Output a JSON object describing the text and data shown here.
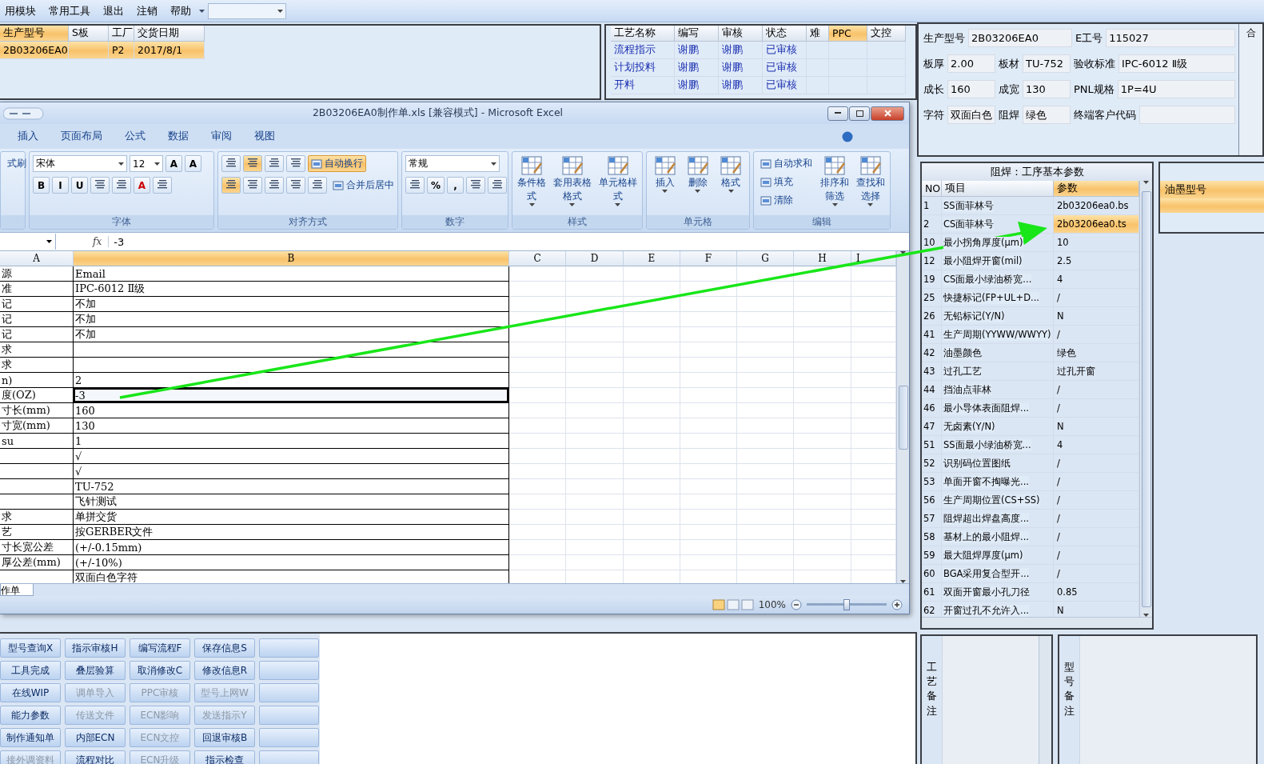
{
  "menu": {
    "items": [
      "用模块",
      "常用工具",
      "退出",
      "注销",
      "帮助"
    ]
  },
  "order_grid": {
    "columns": [
      {
        "label": "生产型号",
        "selected": true
      },
      {
        "label": "S板",
        "selected": false
      },
      {
        "label": "工厂",
        "selected": false
      },
      {
        "label": "交货日期",
        "selected": false
      }
    ],
    "rows": [
      {
        "cells": [
          "2B03206EA0",
          "",
          "P2",
          "2017/8/1"
        ],
        "selected": true
      }
    ]
  },
  "process_grid": {
    "columns": [
      {
        "label": "工艺名称",
        "selected": false
      },
      {
        "label": "编写",
        "selected": false
      },
      {
        "label": "审核",
        "selected": false
      },
      {
        "label": "状态",
        "selected": false
      },
      {
        "label": "难",
        "selected": false
      },
      {
        "label": "PPC",
        "selected": true
      },
      {
        "label": "文控",
        "selected": false
      }
    ],
    "rows": [
      {
        "cells": [
          "流程指示",
          "谢鹏",
          "谢鹏",
          "已审核",
          "",
          "",
          ""
        ]
      },
      {
        "cells": [
          "计划投料",
          "谢鹏",
          "谢鹏",
          "已审核",
          "",
          "",
          ""
        ]
      },
      {
        "cells": [
          "开料",
          "谢鹏",
          "谢鹏",
          "已审核",
          "",
          "",
          ""
        ]
      }
    ]
  },
  "excel": {
    "title": "2B03206EA0制作单.xls  [兼容模式] - Microsoft Excel",
    "tabs": [
      {
        "label": "插入",
        "selected": false
      },
      {
        "label": "页面布局",
        "selected": false
      },
      {
        "label": "公式",
        "selected": false
      },
      {
        "label": "数据",
        "selected": false
      },
      {
        "label": "审阅",
        "selected": false
      },
      {
        "label": "视图",
        "selected": false
      }
    ],
    "groups": [
      {
        "lines": [
          {
            "items": [
              {
                "kind": "small",
                "label": "式刷"
              }
            ]
          }
        ]
      },
      {
        "label": "字体",
        "lines": [
          {
            "items": [
              {
                "kind": "combo",
                "value": "宋体"
              },
              {
                "kind": "combo-small",
                "value": "12"
              },
              {
                "kind": "btn",
                "label": "A"
              },
              {
                "kind": "btn",
                "label": "A"
              }
            ]
          },
          {
            "items": [
              {
                "kind": "btn",
                "label": "B"
              },
              {
                "kind": "btn",
                "label": "I"
              },
              {
                "kind": "btn",
                "label": "U"
              },
              {
                "kind": "icon",
                "selected": false
              },
              {
                "kind": "icon",
                "selected": false
              },
              {
                "kind": "btn",
                "label": "A"
              },
              {
                "kind": "icon",
                "selected": false
              }
            ]
          }
        ]
      },
      {
        "label": "对齐方式",
        "lines": [
          {
            "items": [
              {
                "kind": "icon",
                "selected": false
              },
              {
                "kind": "icon",
                "selected": true
              },
              {
                "kind": "icon",
                "selected": false
              },
              {
                "kind": "icon",
                "selected": false
              },
              {
                "kind": "small",
                "label": "自动换行",
                "selected": true
              }
            ]
          },
          {
            "items": [
              {
                "kind": "icon",
                "selected": true
              },
              {
                "kind": "icon",
                "selected": false
              },
              {
                "kind": "icon",
                "selected": false
              },
              {
                "kind": "icon",
                "selected": false
              },
              {
                "kind": "icon",
                "selected": false
              },
              {
                "kind": "small",
                "label": "合并后居中",
                "selected": false
              }
            ]
          }
        ]
      },
      {
        "label": "数字",
        "lines": [
          {
            "items": [
              {
                "kind": "combo",
                "value": "常规"
              }
            ]
          },
          {
            "items": [
              {
                "kind": "icon",
                "selected": false
              },
              {
                "kind": "btn",
                "label": "%"
              },
              {
                "kind": "btn",
                "label": ","
              },
              {
                "kind": "icon",
                "selected": false
              },
              {
                "kind": "icon",
                "selected": false
              }
            ]
          }
        ]
      },
      {
        "label": "样式",
        "items": [
          {
            "kind": "big",
            "label": "条件格式"
          },
          {
            "kind": "big",
            "label": "套用表格格式"
          },
          {
            "kind": "big",
            "label": "单元格样式"
          }
        ]
      },
      {
        "label": "单元格",
        "items": [
          {
            "kind": "big",
            "label": "插入"
          },
          {
            "kind": "big",
            "label": "删除"
          },
          {
            "kind": "big",
            "label": "格式"
          }
        ]
      },
      {
        "label": "编辑",
        "items": [
          {
            "kind": "stack",
            "items": [
              {
                "kind": "small",
                "label": "自动求和"
              },
              {
                "kind": "small",
                "label": "填充"
              },
              {
                "kind": "small",
                "label": "清除"
              }
            ]
          },
          {
            "kind": "big",
            "label": "排序和筛选"
          },
          {
            "kind": "big",
            "label": "查找和选择"
          }
        ]
      }
    ],
    "fx": "fx",
    "formula": "-3",
    "columns": [
      {
        "label": "A",
        "selected": false
      },
      {
        "label": "B",
        "selected": true
      },
      {
        "label": "C",
        "selected": false
      },
      {
        "label": "D",
        "selected": false
      },
      {
        "label": "E",
        "selected": false
      },
      {
        "label": "F",
        "selected": false
      },
      {
        "label": "G",
        "selected": false
      },
      {
        "label": "H",
        "selected": false
      },
      {
        "label": "I",
        "selected": false
      }
    ],
    "rows": [
      {
        "a": "源",
        "b": "Email",
        "active": false
      },
      {
        "a": "准",
        "b": "IPC-6012 Ⅱ级",
        "active": false
      },
      {
        "a": "记",
        "b": "不加",
        "active": false
      },
      {
        "a": "记",
        "b": "不加",
        "active": false
      },
      {
        "a": "记",
        "b": "不加",
        "active": false
      },
      {
        "a": "求",
        "active": false
      },
      {
        "a": "求",
        "active": false
      },
      {
        "a": "n)",
        "b": "2",
        "active": false
      },
      {
        "a": "度(OZ)",
        "b": "-3",
        "active": true
      },
      {
        "a": "寸长(mm)",
        "b": "160",
        "active": false
      },
      {
        "a": "寸宽(mm)",
        "b": "130",
        "active": false
      },
      {
        "a": "su",
        "b": "1",
        "active": false
      },
      {
        "b": "√",
        "active": false
      },
      {
        "b": "√",
        "active": false
      },
      {
        "b": "TU-752",
        "active": false
      },
      {
        "b": "飞针测试",
        "active": false
      },
      {
        "a": "求",
        "b": "单拼交货",
        "active": false
      },
      {
        "a": "艺",
        "b": "按GERBER文件",
        "active": false
      },
      {
        "a": "寸长宽公差",
        "b": "(+/-0.15mm)",
        "active": false
      },
      {
        "a": "厚公差(mm)",
        "b": "(+/-10%)",
        "active": false
      },
      {
        "b": "双面白色字符",
        "active": false
      }
    ],
    "sheet_tab": "作单",
    "zoom": "100%",
    "zoom_slider": {
      "level": 0.5
    }
  },
  "info": {
    "rows": [
      {
        "fields": [
          {
            "label": "生产型号",
            "value": "2B03206EA0"
          },
          {
            "label": "E工号",
            "value": "115027"
          }
        ]
      },
      {
        "fields": [
          {
            "label": "板厚",
            "value": "2.00"
          },
          {
            "label": "板材",
            "value": "TU-752"
          },
          {
            "label": "验收标准",
            "value": "IPC-6012 Ⅱ级"
          }
        ]
      },
      {
        "fields": [
          {
            "label": "成长",
            "value": "160"
          },
          {
            "label": "成宽",
            "value": "130"
          },
          {
            "label": "PNL规格",
            "value": "1P=4U"
          }
        ]
      },
      {
        "fields": [
          {
            "label": "字符",
            "value": "双面白色"
          },
          {
            "label": "阻焊",
            "value": "绿色"
          },
          {
            "label": "终端客户代码"
          }
        ]
      }
    ],
    "side_label": "合"
  },
  "params": {
    "title": "阻焊：工序基本参数",
    "columns": [
      {
        "label": "NO",
        "selected": false
      },
      {
        "label": "项目",
        "selected": false
      },
      {
        "label": "参数",
        "selected": true
      }
    ],
    "rows": [
      {
        "no": "1",
        "item": "SS面菲林号",
        "value": "2b03206ea0.bs",
        "selected": false
      },
      {
        "no": "2",
        "item": "CS面菲林号",
        "value": "2b03206ea0.ts",
        "selected": true
      },
      {
        "no": "10",
        "item": "最小拐角厚度(μm)",
        "value": "10",
        "selected": false
      },
      {
        "no": "12",
        "item": "最小阻焊开窗(mil)",
        "value": "2.5",
        "selected": false
      },
      {
        "no": "19",
        "item": "CS面最小绿油桥宽...",
        "value": "4",
        "selected": false
      },
      {
        "no": "25",
        "item": "快捷标记(FP+UL+D...",
        "value": "/",
        "selected": false
      },
      {
        "no": "26",
        "item": "无铅标记(Y/N)",
        "value": "N",
        "selected": false
      },
      {
        "no": "41",
        "item": "生产周期(YYWW/WWYY)",
        "value": "/",
        "selected": false
      },
      {
        "no": "42",
        "item": "油墨颜色",
        "value": "绿色",
        "selected": false
      },
      {
        "no": "43",
        "item": "过孔工艺",
        "value": "过孔开窗",
        "selected": false
      },
      {
        "no": "44",
        "item": "挡油点菲林",
        "value": "/",
        "selected": false
      },
      {
        "no": "46",
        "item": "最小导体表面阻焊...",
        "value": "/",
        "selected": false
      },
      {
        "no": "47",
        "item": "无卤素(Y/N)",
        "value": "N",
        "selected": false
      },
      {
        "no": "51",
        "item": "SS面最小绿油桥宽...",
        "value": "4",
        "selected": false
      },
      {
        "no": "52",
        "item": "识别码位置图纸",
        "value": "/",
        "selected": false
      },
      {
        "no": "53",
        "item": "单面开窗不掏曝光...",
        "value": "/",
        "selected": false
      },
      {
        "no": "56",
        "item": "生产周期位置(CS+SS)",
        "value": "/",
        "selected": false
      },
      {
        "no": "57",
        "item": "阻焊超出焊盘高度...",
        "value": "/",
        "selected": false
      },
      {
        "no": "58",
        "item": "基材上的最小阻焊...",
        "value": "/",
        "selected": false
      },
      {
        "no": "59",
        "item": "最大阻焊厚度(μm)",
        "value": "/",
        "selected": false
      },
      {
        "no": "60",
        "item": "BGA采用复合型开...",
        "value": "/",
        "selected": false
      },
      {
        "no": "61",
        "item": "双面开窗最小孔刀径",
        "value": "0.85",
        "selected": false
      },
      {
        "no": "62",
        "item": "开窗过孔不允许入...",
        "value": "N",
        "selected": false
      }
    ]
  },
  "ink": {
    "column": "油墨型号",
    "rows": [
      {
        "selected": true
      }
    ]
  },
  "buttons": [
    [
      {
        "label": "型号查询X",
        "disabled": false
      },
      {
        "label": "指示审核H",
        "disabled": false
      },
      {
        "label": "编写流程F",
        "disabled": false
      },
      {
        "label": "保存信息S",
        "disabled": false
      }
    ],
    [
      {
        "label": "工具完成",
        "disabled": false
      },
      {
        "label": "叠层验算",
        "disabled": false
      },
      {
        "label": "取消修改C",
        "disabled": false
      },
      {
        "label": "修改信息R",
        "disabled": false
      }
    ],
    [
      {
        "label": "在线WIP",
        "disabled": false
      },
      {
        "label": "调单导入",
        "disabled": true
      },
      {
        "label": "PPC审核",
        "disabled": true
      },
      {
        "label": "型号上网W",
        "disabled": true
      }
    ],
    [
      {
        "label": "能力参数",
        "disabled": false
      },
      {
        "label": "传送文件",
        "disabled": true
      },
      {
        "label": "ECN影响",
        "disabled": true
      },
      {
        "label": "发送指示Y",
        "disabled": true
      }
    ],
    [
      {
        "label": "制作通知单",
        "disabled": false
      },
      {
        "label": "内部ECN",
        "disabled": false
      },
      {
        "label": "ECN文控",
        "disabled": true
      },
      {
        "label": "回退审核B",
        "disabled": false
      }
    ],
    [
      {
        "label": "接外调资料",
        "disabled": true
      },
      {
        "label": "流程对比",
        "disabled": false
      },
      {
        "label": "ECN升级",
        "disabled": true
      },
      {
        "label": "指示检查",
        "disabled": false
      }
    ]
  ],
  "remarks": [
    {
      "label": "工艺备注"
    },
    {
      "label": "型号备注"
    }
  ]
}
